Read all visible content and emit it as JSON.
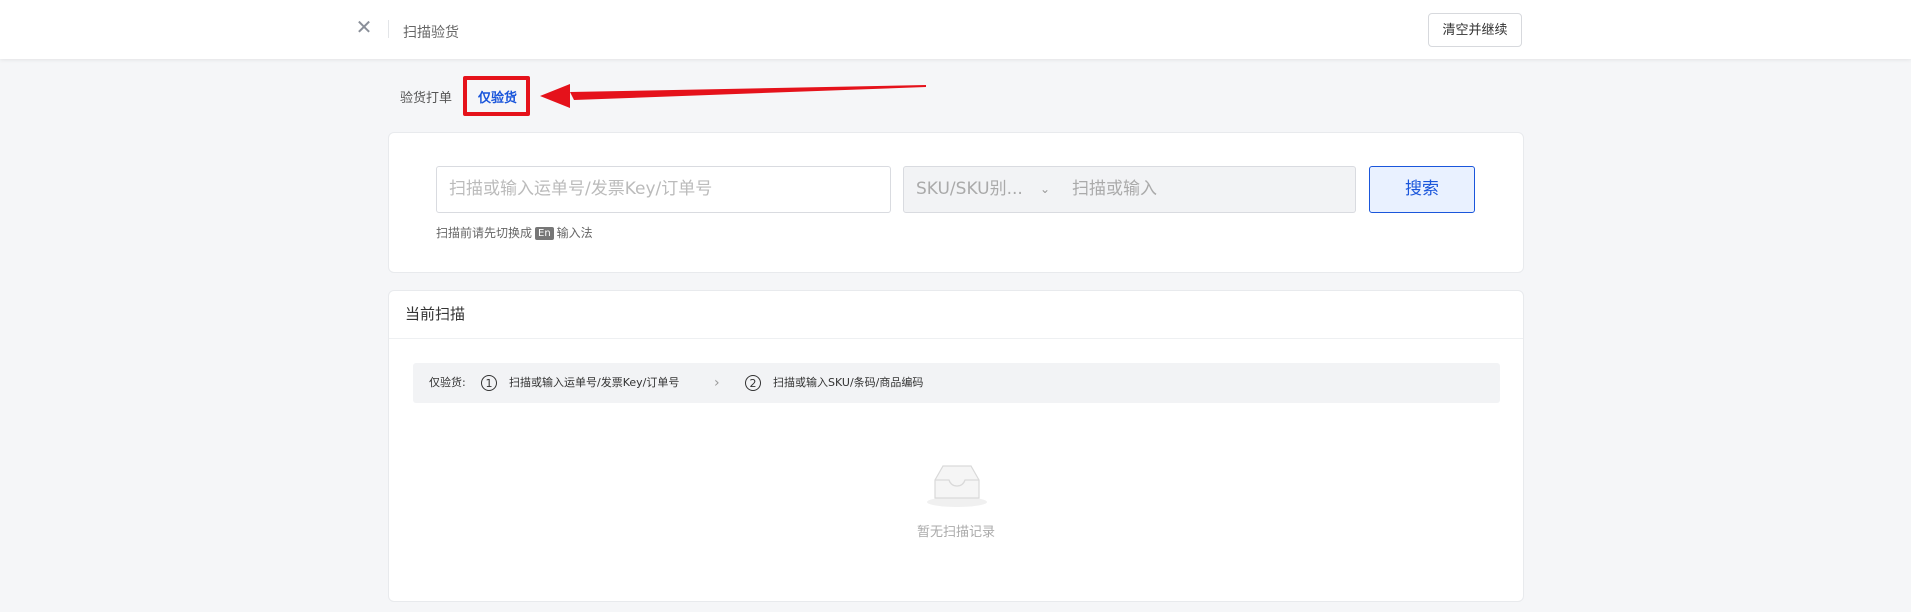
{
  "header": {
    "title": "扫描验货",
    "clear_label": "清空并继续"
  },
  "tabs": [
    {
      "label": "验货打单"
    },
    {
      "label": "仅验货"
    }
  ],
  "search": {
    "main_placeholder": "扫描或输入运单号/发票Key/订单号",
    "sku_select_value": "SKU/SKU别...",
    "sku_placeholder": "扫描或输入",
    "search_label": "搜索",
    "hint_before": "扫描前请先切换成",
    "hint_badge": "En",
    "hint_after": "输入法"
  },
  "scan": {
    "title": "当前扫描",
    "step_prefix": "仅验货:",
    "step1_num": "1",
    "step1_text": "扫描或输入运单号/发票Key/订单号",
    "step2_num": "2",
    "step2_text": "扫描或输入SKU/条码/商品编码",
    "empty_text": "暂无扫描记录"
  },
  "colors": {
    "accent": "#1a56db",
    "highlight": "#e5121b"
  }
}
